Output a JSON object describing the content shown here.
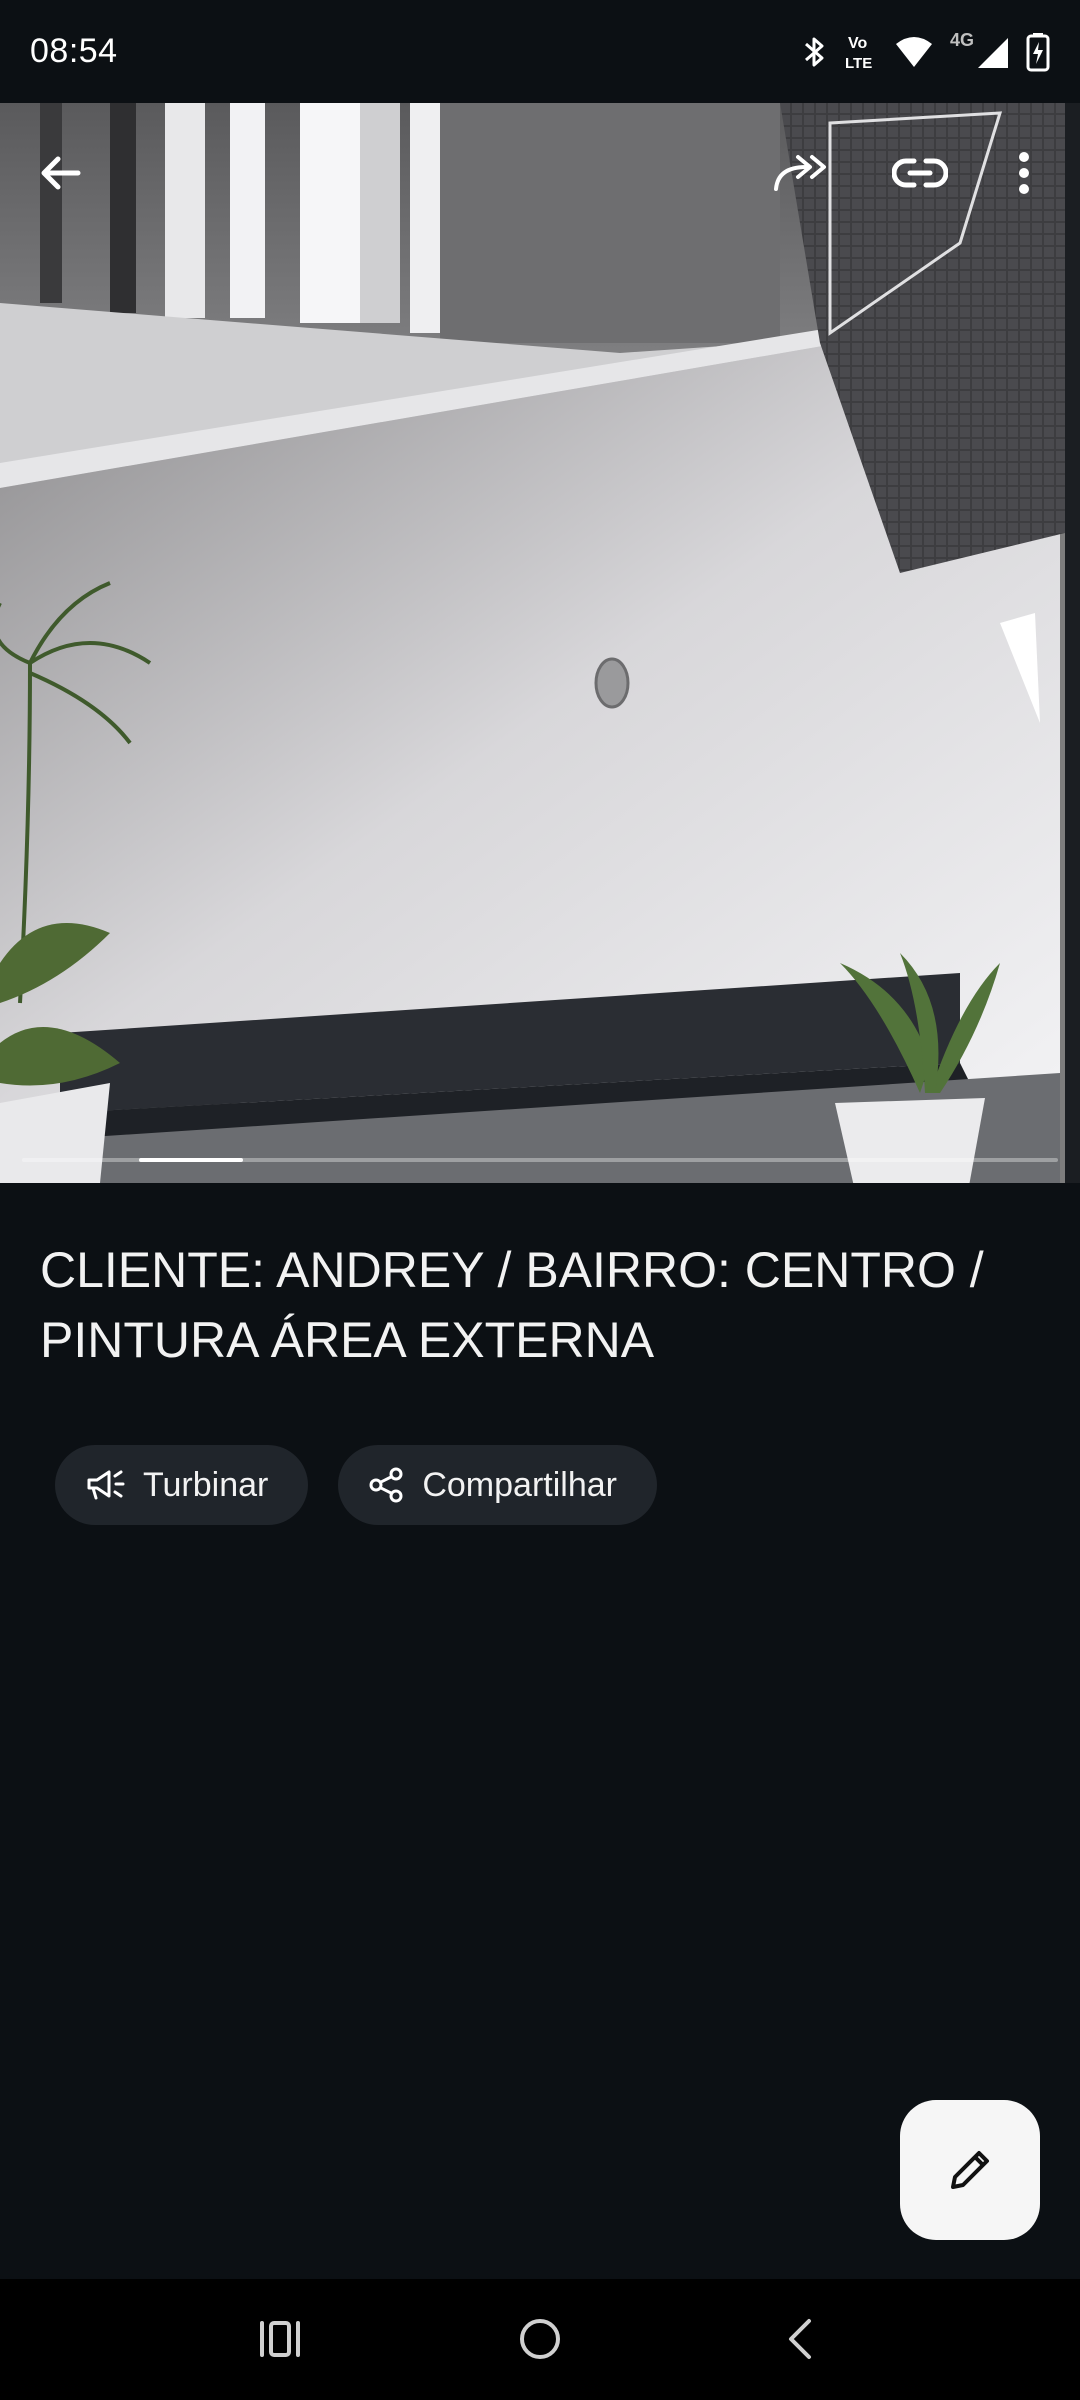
{
  "status_bar": {
    "time": "08:54",
    "network_label": "4G",
    "volte_label_top": "Vo",
    "volte_label_bottom": "LTE"
  },
  "media": {
    "carousel_progress_fraction": 0.1,
    "carousel_progress_start_fraction": 0.113
  },
  "post": {
    "title": "CLIENTE: ANDREY / BAIRRO: CENTRO / PINTURA ÁREA EXTERNA"
  },
  "actions": {
    "boost_label": "Turbinar",
    "share_label": "Compartilhar"
  },
  "icons": {
    "back": "arrow-left-icon",
    "forward": "share-forward-icon",
    "link": "link-icon",
    "more": "more-vertical-icon",
    "boost": "megaphone-icon",
    "share": "share-nodes-icon",
    "edit": "pencil-icon",
    "recents": "recents-icon",
    "home": "home-icon",
    "nav_back": "chevron-left-icon"
  },
  "colors": {
    "background": "#0c1014",
    "chip_background": "#20252b",
    "fab_background": "#f6f6f6"
  }
}
